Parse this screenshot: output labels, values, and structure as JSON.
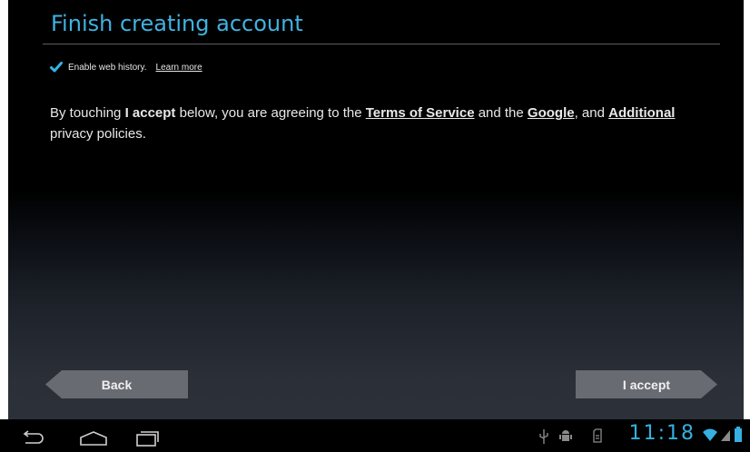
{
  "header": {
    "title": "Finish creating account"
  },
  "web_history": {
    "label": "Enable web history.",
    "link": "Learn more",
    "checked": true
  },
  "agreement": {
    "part1": "By touching ",
    "accept_word": "I accept",
    "part2": " below, you are agreeing to the ",
    "tos": "Terms of Service",
    "part3": " and the ",
    "google": "Google",
    "part4": ", and ",
    "additional": "Additional",
    "part5": " privacy policies."
  },
  "buttons": {
    "back": "Back",
    "accept": "I accept"
  },
  "status_bar": {
    "time": "11:18"
  },
  "colors": {
    "accent": "#33B5E5",
    "button": "#686C72"
  },
  "icons": {
    "nav": [
      "back-icon",
      "home-icon",
      "recent-apps-icon"
    ],
    "status": [
      "usb-icon",
      "android-debug-icon",
      "sd-card-icon",
      "wifi-icon",
      "signal-icon",
      "battery-icon"
    ]
  }
}
